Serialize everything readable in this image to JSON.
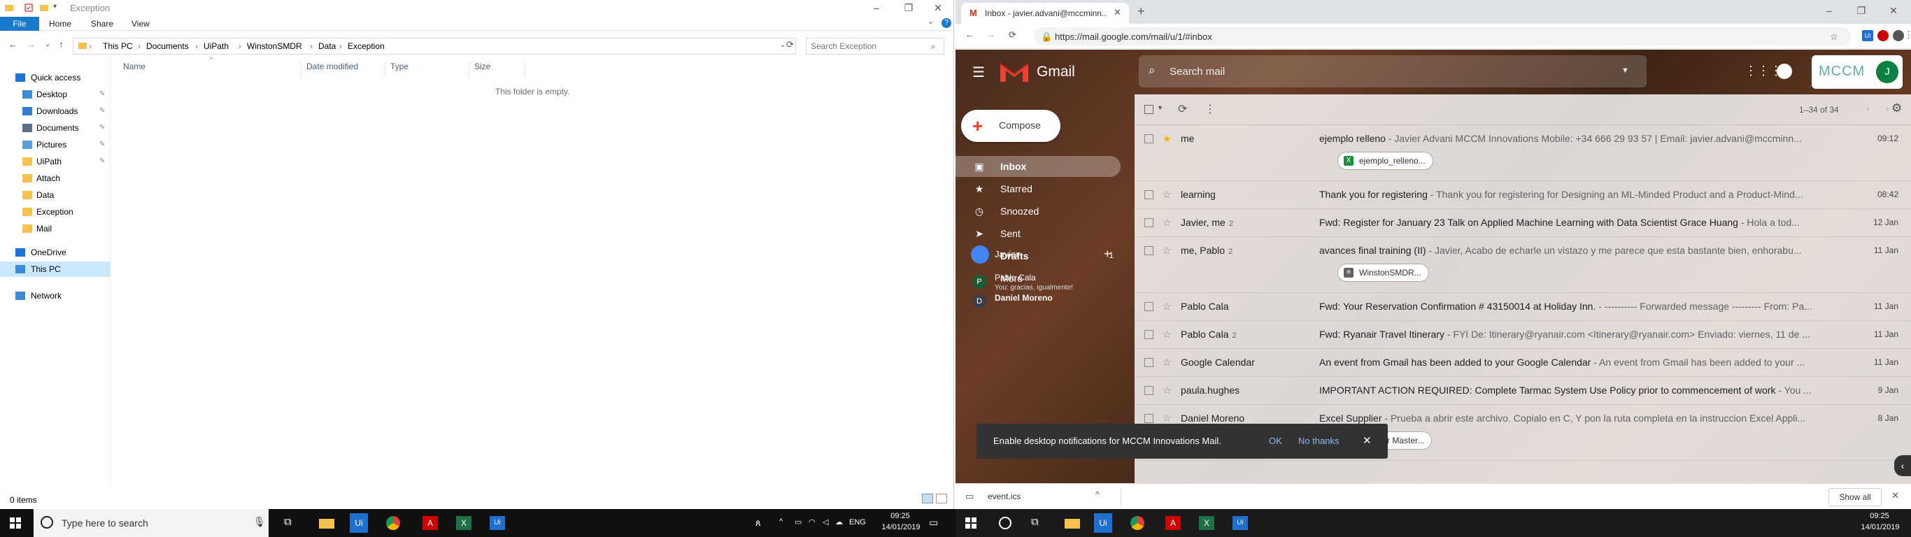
{
  "explorer": {
    "title": "Exception",
    "ribbon_tabs": [
      "File",
      "Home",
      "Share",
      "View"
    ],
    "breadcrumb": [
      "This PC",
      "Documents",
      "UiPath",
      "WinstonSMDR",
      "Data",
      "Exception"
    ],
    "search_placeholder": "Search Exception",
    "nav": [
      {
        "label": "Quick access",
        "icon": "star-icon"
      },
      {
        "label": "Desktop",
        "icon": "desktop-icon",
        "pinned": true
      },
      {
        "label": "Downloads",
        "icon": "download-icon",
        "pinned": true
      },
      {
        "label": "Documents",
        "icon": "documents-icon",
        "pinned": true
      },
      {
        "label": "Pictures",
        "icon": "pictures-icon",
        "pinned": true
      },
      {
        "label": "UiPath",
        "icon": "folder-icon",
        "pinned": true
      },
      {
        "label": "Attach",
        "icon": "folder-icon"
      },
      {
        "label": "Data",
        "icon": "folder-icon"
      },
      {
        "label": "Exception",
        "icon": "folder-icon"
      },
      {
        "label": "Mail",
        "icon": "folder-icon"
      },
      {
        "label": "OneDrive",
        "icon": "cloud-icon"
      },
      {
        "label": "This PC",
        "icon": "pc-icon",
        "selected": true
      },
      {
        "label": "Network",
        "icon": "network-icon"
      }
    ],
    "columns": [
      "Name",
      "Date modified",
      "Type",
      "Size"
    ],
    "empty_message": "This folder is empty.",
    "status": "0 items"
  },
  "chrome": {
    "tab_title": "Inbox - javier.advani@mccminn...",
    "url": "https://mail.google.com/mail/u/1/#inbox",
    "download_file": "event.ics",
    "show_all": "Show all"
  },
  "gmail": {
    "logo": "Gmail",
    "search_placeholder": "Search mail",
    "account_label": "MCCM",
    "avatar_letter": "J",
    "compose": "Compose",
    "nav": [
      {
        "label": "Inbox",
        "icon": "inbox-icon",
        "active": true,
        "bold": true
      },
      {
        "label": "Starred",
        "icon": "star-icon"
      },
      {
        "label": "Snoozed",
        "icon": "clock-icon"
      },
      {
        "label": "Sent",
        "icon": "send-icon"
      },
      {
        "label": "Drafts",
        "icon": "draft-icon",
        "count": "1",
        "bold": true
      },
      {
        "label": "More",
        "icon": "chevron-down-icon"
      }
    ],
    "hangouts": {
      "me": "Javier",
      "contacts": [
        {
          "initial": "P",
          "name": "Pablo Cala",
          "status": "You: gracias, igualmente!"
        },
        {
          "initial": "D",
          "name": "Daniel Moreno",
          "status": ""
        }
      ]
    },
    "page_count": "1–34 of 34",
    "emails": [
      {
        "sender": "me",
        "count": "",
        "subject": "ejemplo relleno",
        "preview": " - Javier Advani MCCM Innovations Mobile: +34 666 29 93 57 | Email: javier.advani@mccminn...",
        "date": "09:12",
        "starred": true,
        "attachment": "ejemplo_relleno...",
        "attachment_color": "#1e8e3e",
        "attachment_letter": "X"
      },
      {
        "sender": "learning",
        "count": "",
        "subject": "Thank you for registering",
        "preview": " - Thank you for registering for Designing an ML-Minded Product and a Product-Mind...",
        "date": "08:42"
      },
      {
        "sender": "Javier, me",
        "count": "2",
        "subject": "Fwd: Register for January 23 Talk on Applied Machine Learning with Data Scientist Grace Huang",
        "preview": " - Hola a tod...",
        "date": "12 Jan"
      },
      {
        "sender": "me, Pablo",
        "count": "2",
        "subject": "avances final training (II)",
        "preview": " - Javier, Acabo de echarle un vistazo y me parece que esta bastante bien, enhorabu...",
        "date": "11 Jan",
        "attachment": "WinstonSMDR...",
        "attachment_color": "#5f6368",
        "attachment_letter": "≡"
      },
      {
        "sender": "Pablo Cala",
        "count": "",
        "subject": "Fwd: Your Reservation Confirmation # 43150014 at Holiday Inn.",
        "preview": " - ---------- Forwarded message --------- From: Pa...",
        "date": "11 Jan"
      },
      {
        "sender": "Pablo Cala",
        "count": "2",
        "subject": "Fwd: Ryanair Travel Itinerary",
        "preview": " - FYI De: Itinerary@ryanair.com <Itinerary@ryanair.com> Enviado: viernes, 11 de ...",
        "date": "11 Jan"
      },
      {
        "sender": "Google Calendar",
        "count": "",
        "subject": "An event from Gmail has been added to your Google Calendar",
        "preview": " - An event from Gmail has been added to your ...",
        "date": "11 Jan"
      },
      {
        "sender": "paula.hughes",
        "count": "",
        "subject": "IMPORTANT ACTION REQUIRED: Complete Tarmac System Use Policy prior to commencement of work",
        "preview": " - You ...",
        "date": "9 Jan"
      },
      {
        "sender": "Daniel Moreno",
        "count": "",
        "subject": "Excel Supplier",
        "preview": " - Prueba a abrir este archivo. Copialo en C, Y pon la ruta completa en la instruccion Excel Appli...",
        "date": "8 Jan",
        "attachment": "Supplier Master...",
        "attachment_color": "#1e8e3e",
        "attachment_letter": "X"
      }
    ],
    "notification": {
      "message": "Enable desktop notifications for MCCM Innovations Mail.",
      "ok": "OK",
      "no": "No thanks"
    }
  },
  "taskbar_left": {
    "search_placeholder": "Type here to search",
    "lang": "ENG",
    "time": "09:25",
    "date": "14/01/2019"
  },
  "taskbar_right": {
    "time": "09:25",
    "date": "14/01/2019"
  }
}
